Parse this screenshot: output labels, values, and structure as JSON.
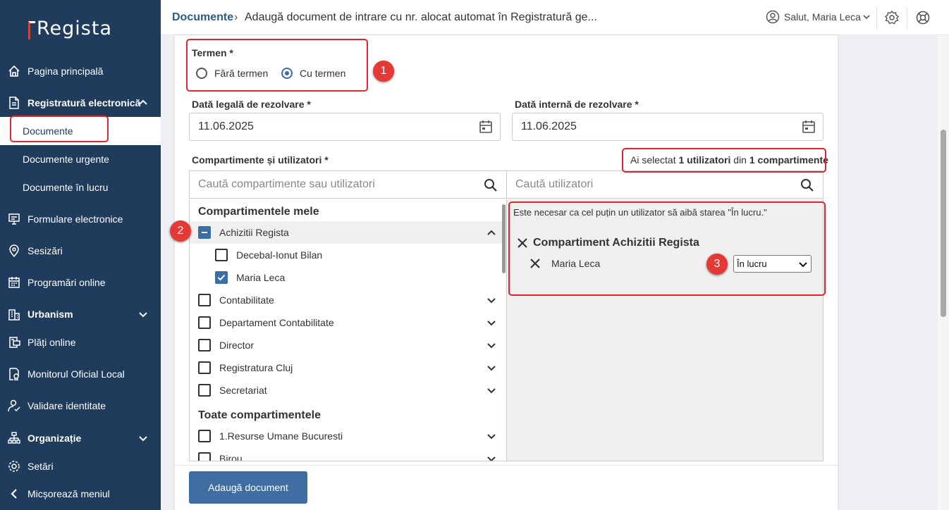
{
  "sidebar": {
    "logo": "Regista",
    "items": [
      {
        "label": "Pagina principală",
        "icon": "home-icon"
      },
      {
        "label": "Registratură electronică",
        "icon": "document-icon"
      },
      {
        "label": "Formulare electronice",
        "icon": "monitor-icon"
      },
      {
        "label": "Sesizări",
        "icon": "location-pin-icon"
      },
      {
        "label": "Programări online",
        "icon": "calendar-icon"
      },
      {
        "label": "Urbanism",
        "icon": "building-icon"
      },
      {
        "label": "Plăți online",
        "icon": "payment-icon"
      },
      {
        "label": "Monitorul Oficial Local",
        "icon": "certificate-icon"
      },
      {
        "label": "Validare identitate",
        "icon": "user-check-icon"
      },
      {
        "label": "Organizație",
        "icon": "org-chart-icon"
      },
      {
        "label": "Setări",
        "icon": "gear-icon"
      },
      {
        "label": "Micșorează meniul",
        "icon": "chevron-left-icon"
      }
    ],
    "subitems": [
      "Documente",
      "Documente urgente",
      "Documente în lucru"
    ]
  },
  "header": {
    "breadcrumb_root": "Documente",
    "breadcrumb_sep": "›",
    "breadcrumb_current": "Adaugă document de intrare cu nr. alocat automat în Registratură ge...",
    "user_greeting": "Salut, Maria Leca"
  },
  "form": {
    "termen_label": "Termen *",
    "radio_no_term": "Fără termen",
    "radio_with_term": "Cu termen",
    "legal_date_label": "Dată legală de rezolvare *",
    "legal_date_value": "11.06.2025",
    "internal_date_label": "Dată internă de rezolvare *",
    "internal_date_value": "11.06.2025",
    "compartments_label": "Compartimente și utilizatori *",
    "selected_prefix": "Ai selectat",
    "selected_users": "1 utilizatori",
    "selected_mid": "din",
    "selected_compartments": "1 compartimente",
    "search_compartments_placeholder": "Caută compartimente sau utilizatori",
    "search_users_placeholder": "Caută utilizatori",
    "my_compartments_title": "Compartimentele mele",
    "all_compartments_title": "Toate compartimentele",
    "my_compartments": [
      "Achizitii Regista",
      "Decebal-Ionut Bilan",
      "Maria Leca",
      "Contabilitate",
      "Departament Contabilitate",
      "Director",
      "Registratura Cluj",
      "Secretariat"
    ],
    "all_compartments": [
      "1.Resurse Umane Bucuresti",
      "Birou"
    ],
    "notice": "Este necesar ca cel puțin un utilizator să aibă starea \"În lucru.\"",
    "selected_compartment": "Compartiment Achizitii Regista",
    "selected_user": "Maria Leca",
    "user_status": "În lucru",
    "add_button": "Adaugă document"
  },
  "badges": [
    "1",
    "2",
    "3"
  ]
}
